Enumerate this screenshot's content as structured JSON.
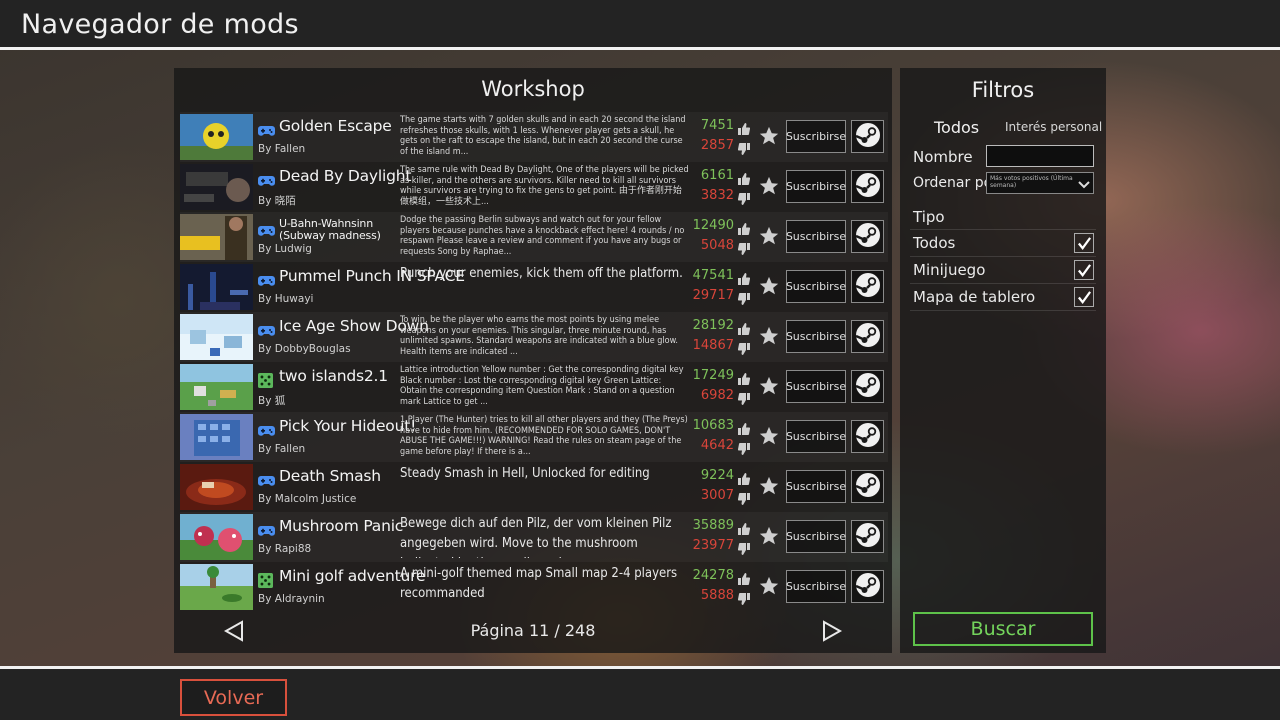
{
  "window": {
    "title": "Navegador de mods"
  },
  "workshop": {
    "title": "Workshop",
    "page_label": "Página 11 / 248",
    "subscribe_label": "Suscribirse",
    "mods": [
      {
        "name": "Golden Escape",
        "author": "By Fallen",
        "type": "gamepad-icon",
        "desc": "The game starts with 7 golden skulls and in each 20 second the island refreshes those skulls, with 1 less. Whenever player gets a skull, he gets on the raft to escape the island, but in each 20 second the curse of the island m...",
        "up": "7451",
        "down": "2857"
      },
      {
        "name": "Dead By Daylight",
        "author": "By 晓陌",
        "type": "gamepad-icon",
        "desc": "The same rule with Dead By Daylight, One of the players will be picked as killer, and the others are survivors. Killer need to kill all survivors while survivors are trying to fix the gens to get point. 由于作者刚开始做模组，一些技术上...",
        "up": "6161",
        "down": "3832"
      },
      {
        "name": "U-Bahn-Wahnsinn (Subway madness)",
        "author": "By Ludwig",
        "type": "gamepad-icon",
        "desc": "Dodge the passing Berlin subways and watch out for your fellow players because punches have a knockback effect here! 4 rounds / no respawn Please leave a review and comment if you have any bugs or requests Song by Raphae...",
        "up": "12490",
        "down": "5048"
      },
      {
        "name": "Pummel Punch IN SPACE",
        "author": "By Huwayi",
        "type": "gamepad-icon",
        "desc": "Punch your enemies, kick them off the platform.",
        "up": "47541",
        "down": "29717"
      },
      {
        "name": "Ice Age Show Down",
        "author": "By DobbyBouglas",
        "type": "gamepad-icon",
        "desc": "To win, be the player who earns the most points by using melee weapons on your enemies. This singular, three minute round, has unlimited spawns. Standard weapons are indicated with a blue glow. Health items are indicated ...",
        "up": "28192",
        "down": "14867"
      },
      {
        "name": "two islands2.1",
        "author": "By 狐",
        "type": "board-icon",
        "desc": "Lattice introduction Yellow number : Get the corresponding digital key Black number : Lost the corresponding digital key Green Lattice: Obtain the corresponding item Question Mark : Stand on a question mark Lattice to get ...",
        "up": "17249",
        "down": "6982"
      },
      {
        "name": "Pick Your Hideout!",
        "author": "By Fallen",
        "type": "gamepad-icon",
        "desc": "1 Player (The Hunter) tries to kill all other players and they (The Preys) have to hide from him. (RECOMMENDED FOR SOLO GAMES, DON'T ABUSE THE GAME!!!) WARNING! Read the rules on steam page of the game before play! If there is a...",
        "up": "10683",
        "down": "4642"
      },
      {
        "name": "Death Smash",
        "author": "By Malcolm Justice",
        "type": "gamepad-icon",
        "desc": "Steady Smash in Hell, Unlocked for editing",
        "up": "9224",
        "down": "3007"
      },
      {
        "name": "Mushroom Panic",
        "author": "By Rapi88",
        "type": "gamepad-icon",
        "desc": "Bewege dich auf den Pilz, der vom kleinen Pilz angegeben wird. Move to the mushroom indicated by the small mushroom.",
        "up": "35889",
        "down": "23977"
      },
      {
        "name": "Mini golf adventure",
        "author": "By Aldraynin",
        "type": "board-icon",
        "desc": "A mini-golf themed map Small map 2-4 players recommanded",
        "up": "24278",
        "down": "5888"
      }
    ]
  },
  "filters": {
    "title": "Filtros",
    "tab_all": "Todos",
    "tab_interest": "Interés personal",
    "name_label": "Nombre",
    "name_value": "",
    "order_label": "Ordenar por",
    "order_value": "Más votos positivos (Última semana)",
    "type_label": "Tipo",
    "types": [
      {
        "label": "Todos",
        "checked": true
      },
      {
        "label": "Minijuego",
        "checked": true
      },
      {
        "label": "Mapa de tablero",
        "checked": true
      }
    ],
    "search_label": "Buscar"
  },
  "footer": {
    "back_label": "Volver"
  },
  "colors": {
    "upvote": "#7ec15a",
    "downvote": "#d9453a",
    "search": "#5ec24a",
    "back": "#d8503c",
    "gamepad": "#4a8ef0",
    "board": "#5cb85c"
  }
}
